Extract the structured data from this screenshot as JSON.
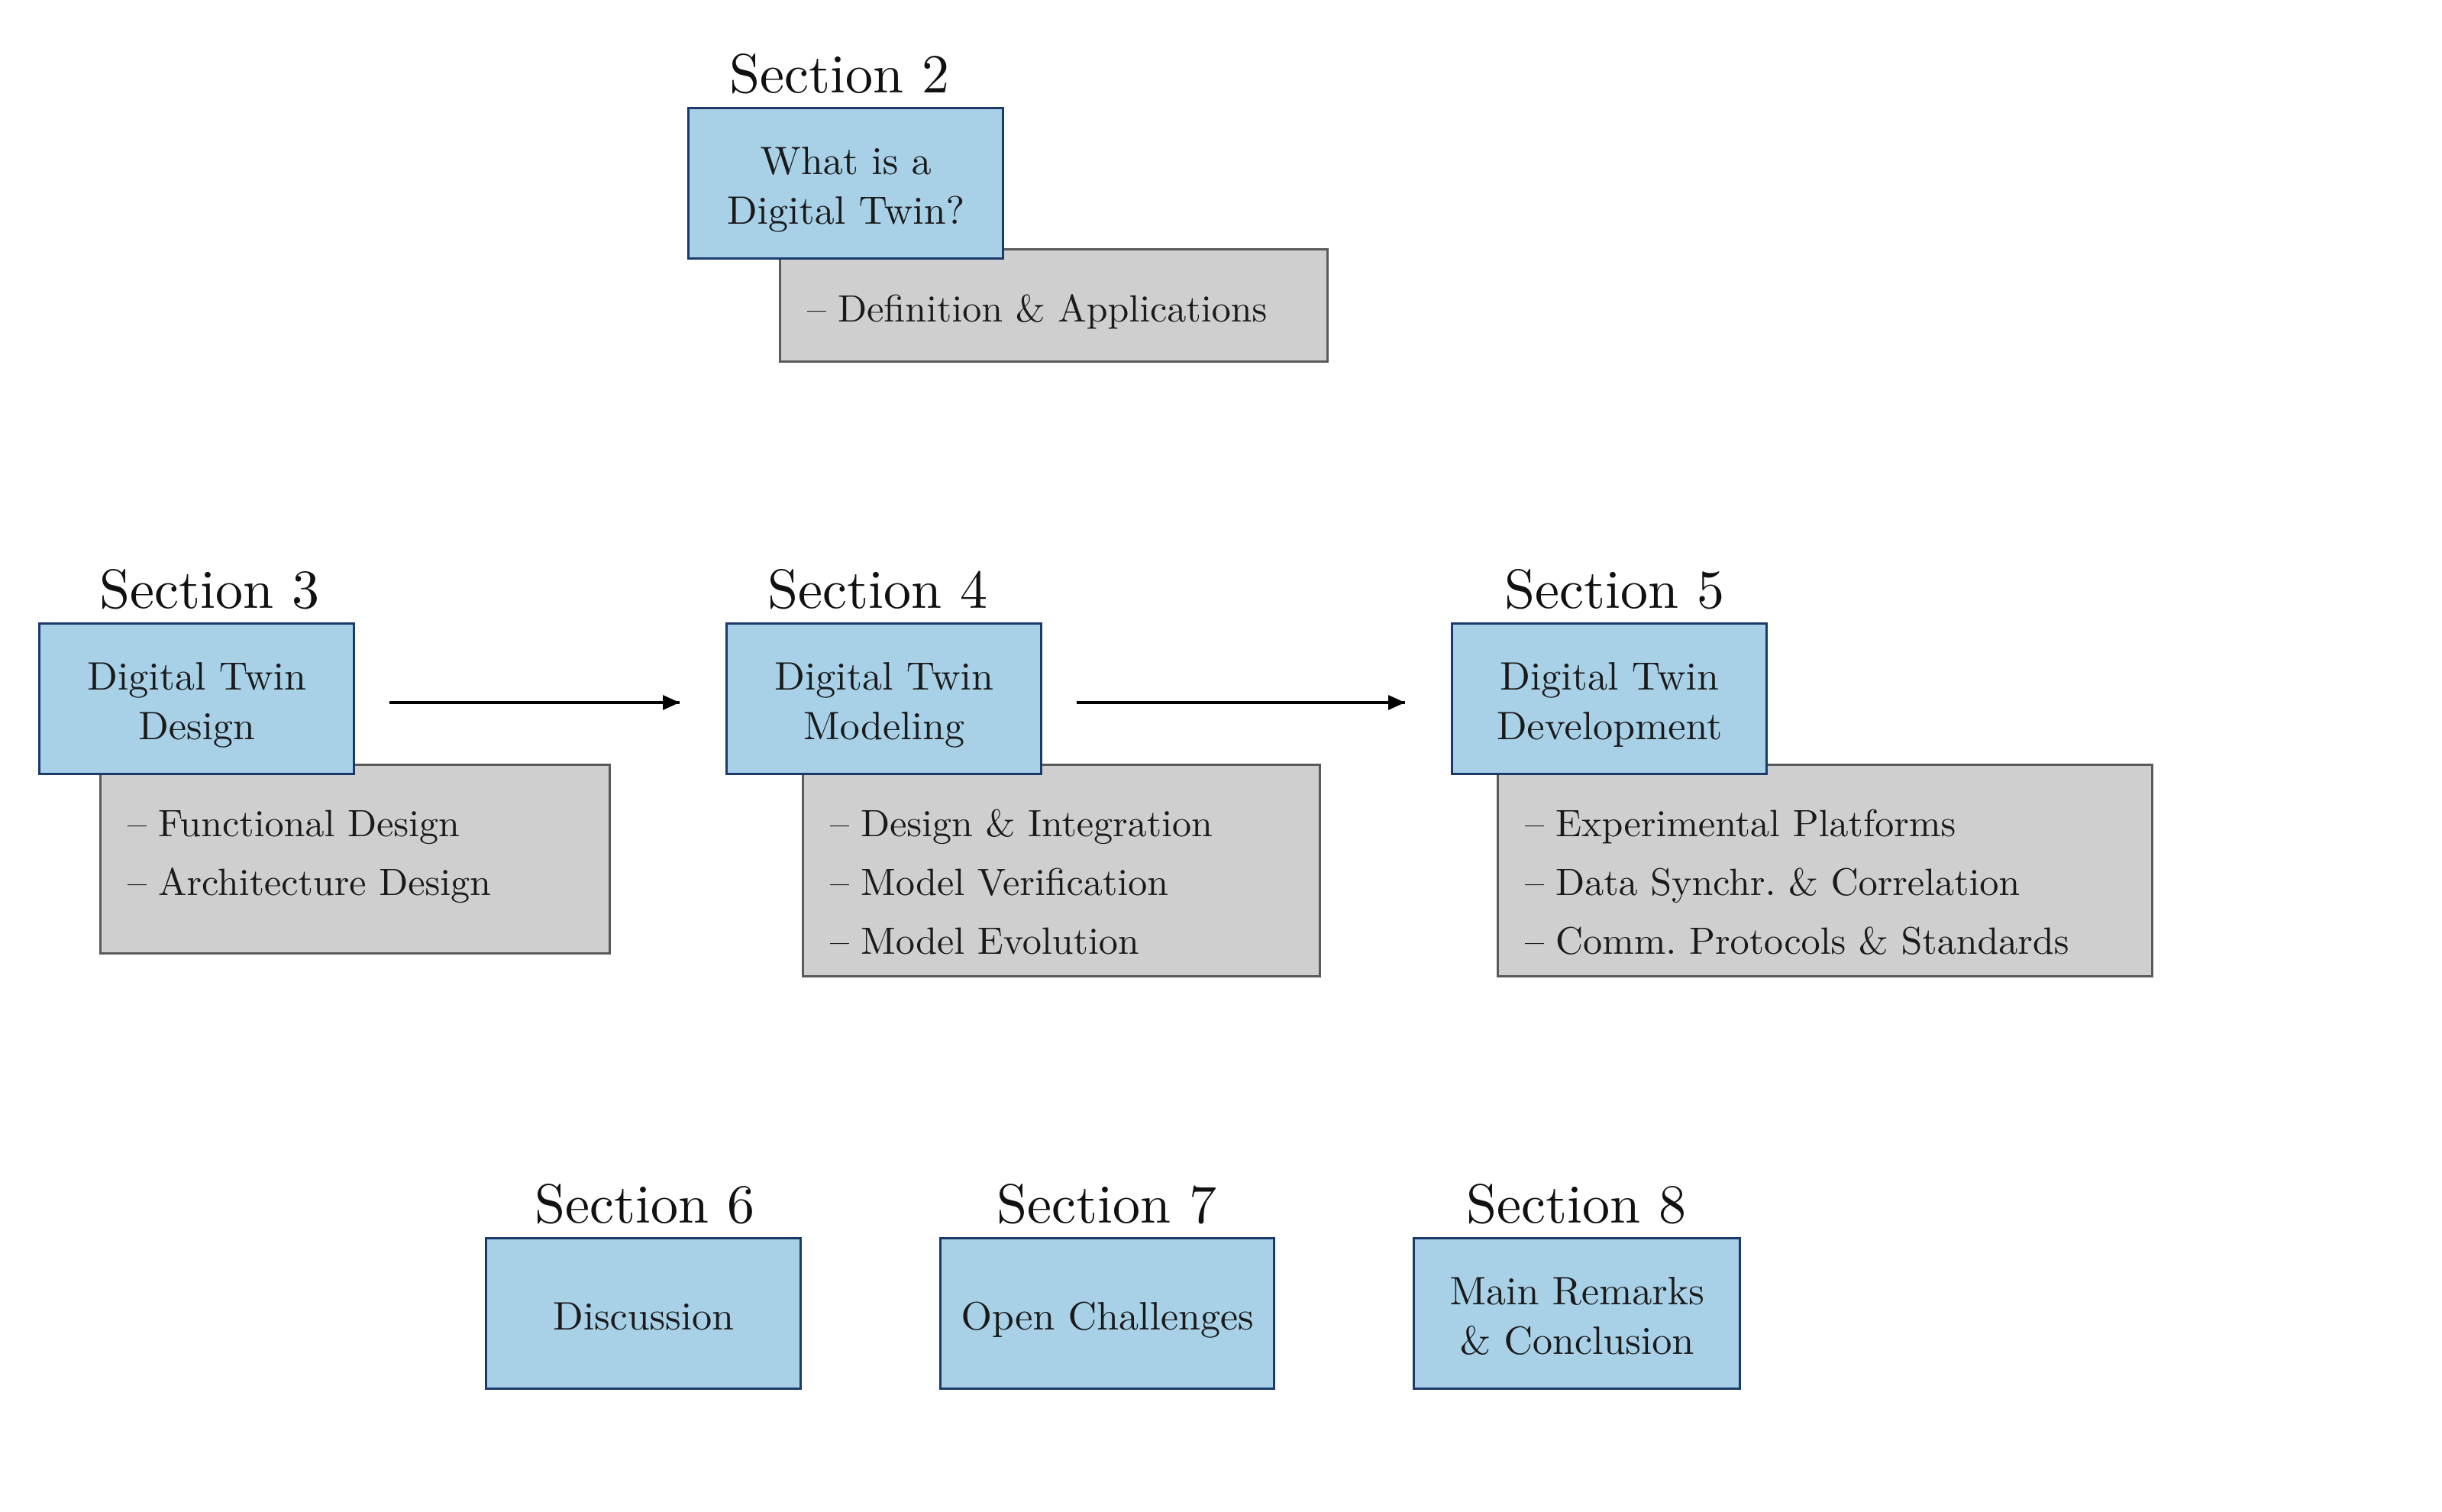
{
  "sections": {
    "s2": {
      "label": "Section 2",
      "title": "What is a\nDigital Twin?",
      "items": [
        "Definition & Applications"
      ]
    },
    "s3": {
      "label": "Section 3",
      "title": "Digital Twin\nDesign",
      "items": [
        "Functional Design",
        "Architecture Design"
      ]
    },
    "s4": {
      "label": "Section 4",
      "title": "Digital Twin\nModeling",
      "items": [
        "Design & Integration",
        "Model Verification",
        "Model Evolution"
      ]
    },
    "s5": {
      "label": "Section 5",
      "title": "Digital Twin\nDevelopment",
      "items": [
        "Experimental Platforms",
        "Data Synchr. & Correlation",
        "Comm. Protocols & Standards"
      ]
    },
    "s6": {
      "label": "Section 6",
      "title": "Discussion"
    },
    "s7": {
      "label": "Section 7",
      "title": "Open Challenges"
    },
    "s8": {
      "label": "Section 8",
      "title": "Main Remarks\n& Conclusion"
    }
  },
  "bullet_glyph": "–"
}
